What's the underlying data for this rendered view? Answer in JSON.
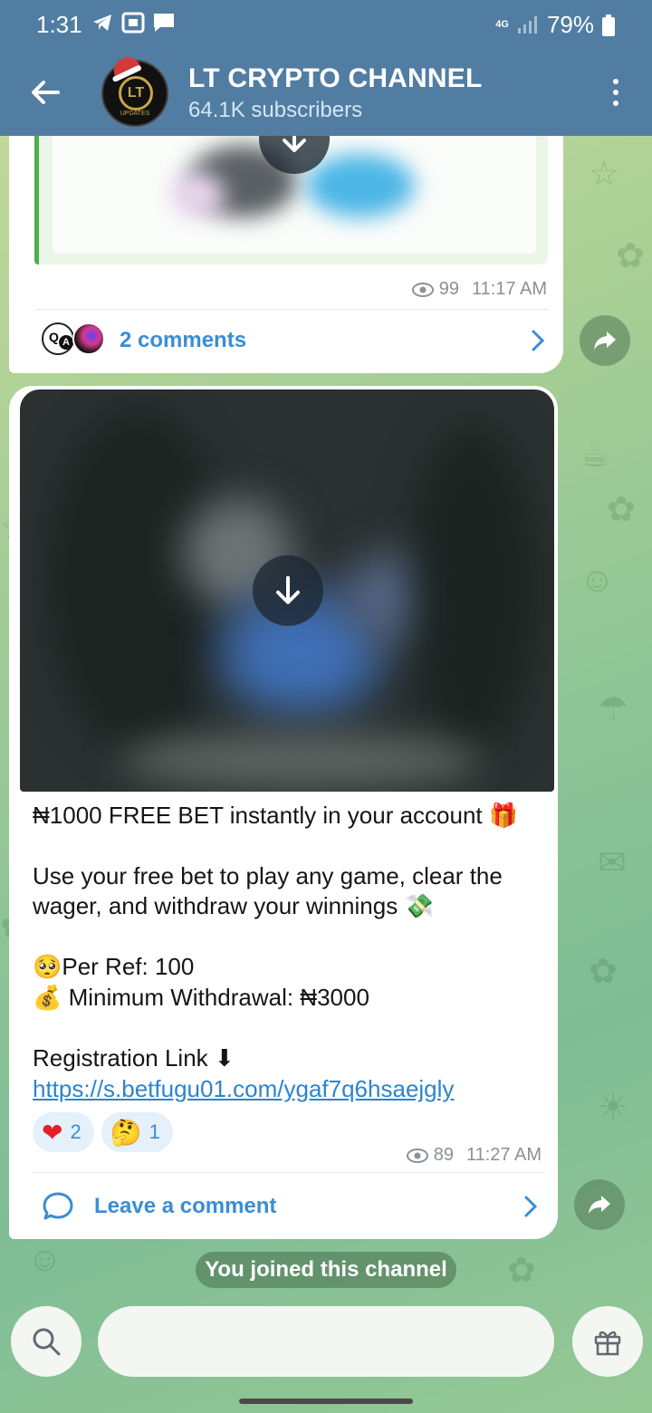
{
  "status_bar": {
    "time": "1:31",
    "network": "4G",
    "battery": "79%"
  },
  "header": {
    "title": "LT CRYPTO CHANNEL",
    "subtitle": "64.1K subscribers",
    "avatar_text": "LT",
    "avatar_sub": "UPDATES"
  },
  "post1": {
    "views": "99",
    "time": "11:17 AM",
    "comments_label": "2 comments",
    "commenter_badges": [
      "Q",
      "A"
    ]
  },
  "post2": {
    "lines": [
      "₦1000 FREE BET instantly in your account",
      "Use your free bet to play any game, clear the wager, and withdraw your winnings",
      "Per Ref: 100",
      " Minimum Withdrawal: ₦3000",
      "Registration Link"
    ],
    "emojis": {
      "gift": "🎁",
      "money_wings": "💸",
      "pleading": "🥺",
      "money_bag": "💰",
      "down_arrow": "⬇"
    },
    "link": "https://s.betfugu01.com/ygaf7q6hsaejgly",
    "reactions": [
      {
        "emoji": "❤",
        "count": "2"
      },
      {
        "emoji": "🤔",
        "count": "1"
      }
    ],
    "views": "89",
    "time": "11:27 AM",
    "comment_label": "Leave a comment"
  },
  "system_message": "You joined this channel",
  "colors": {
    "header_bg": "#517da2",
    "link": "#3a8dd6",
    "accent_green": "#4fae4e"
  }
}
